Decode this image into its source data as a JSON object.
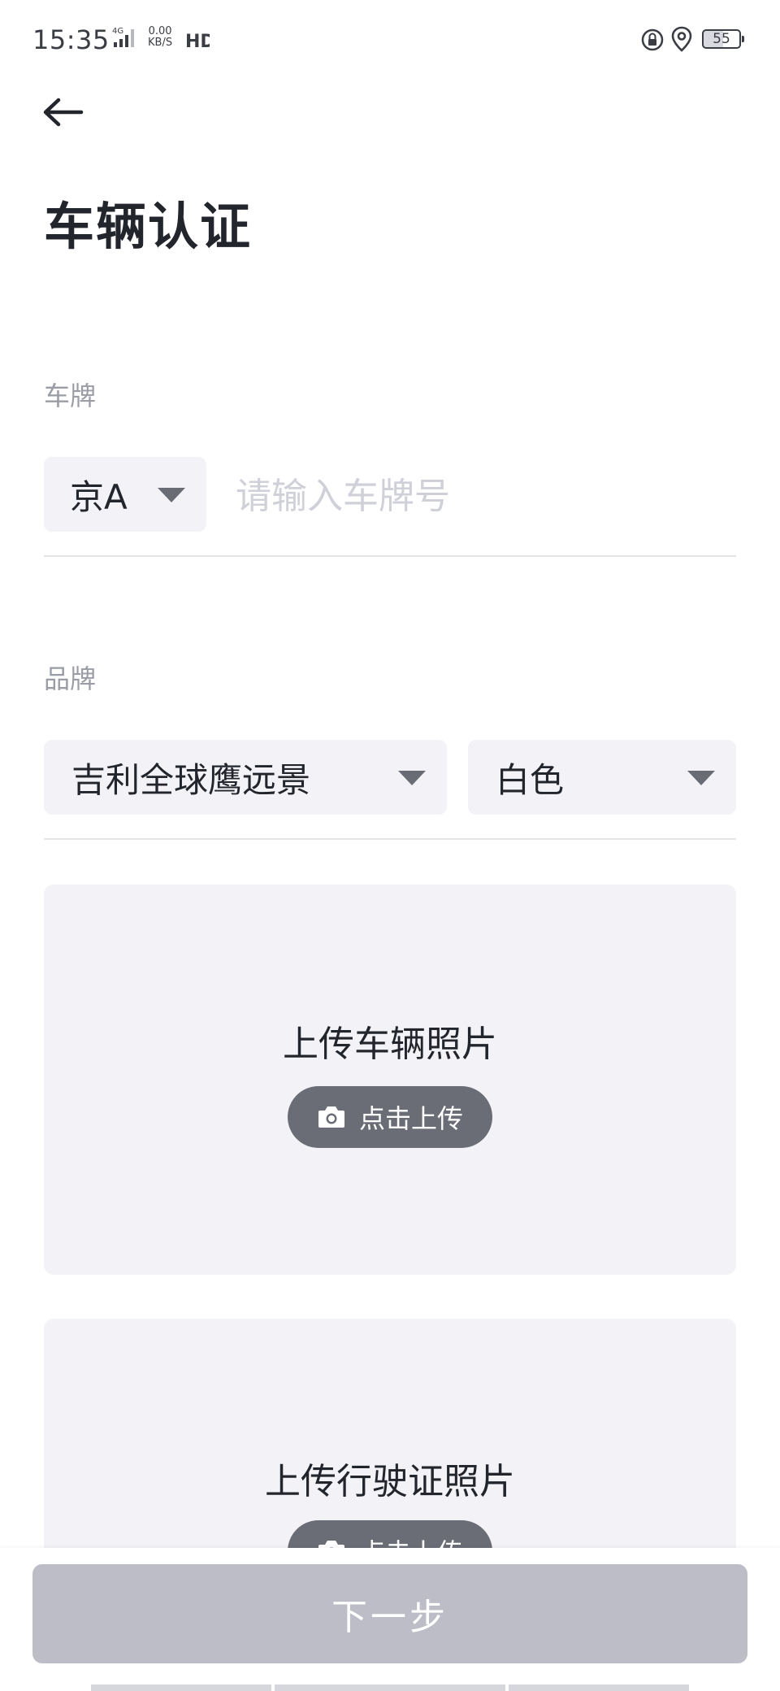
{
  "status_bar": {
    "time": "15:35",
    "network_type": "4G",
    "speed_value": "0.00",
    "speed_unit": "KB/S",
    "hd": "HD",
    "battery": "55"
  },
  "header": {
    "back_icon": "arrow-left-icon",
    "title": "车辆认证"
  },
  "plate_section": {
    "label": "车牌",
    "region_value": "京A",
    "plate_placeholder": "请输入车牌号",
    "plate_value": ""
  },
  "brand_section": {
    "label": "品牌",
    "brand_value": "吉利全球鹰远景",
    "color_value": "白色"
  },
  "vehicle_photo": {
    "title": "上传车辆照片",
    "button_label": "点击上传",
    "button_icon": "camera-icon"
  },
  "license_photo": {
    "title": "上传行驶证照片",
    "button_label": "点击上传",
    "button_icon": "camera-icon"
  },
  "footer": {
    "next_label": "下一步"
  },
  "colors": {
    "panel_bg": "#f3f3f7",
    "upload_button": "#6b6d76",
    "next_button_disabled": "#bcbdc6",
    "label_gray": "#9a9ca6",
    "title_dark": "#23252d"
  }
}
